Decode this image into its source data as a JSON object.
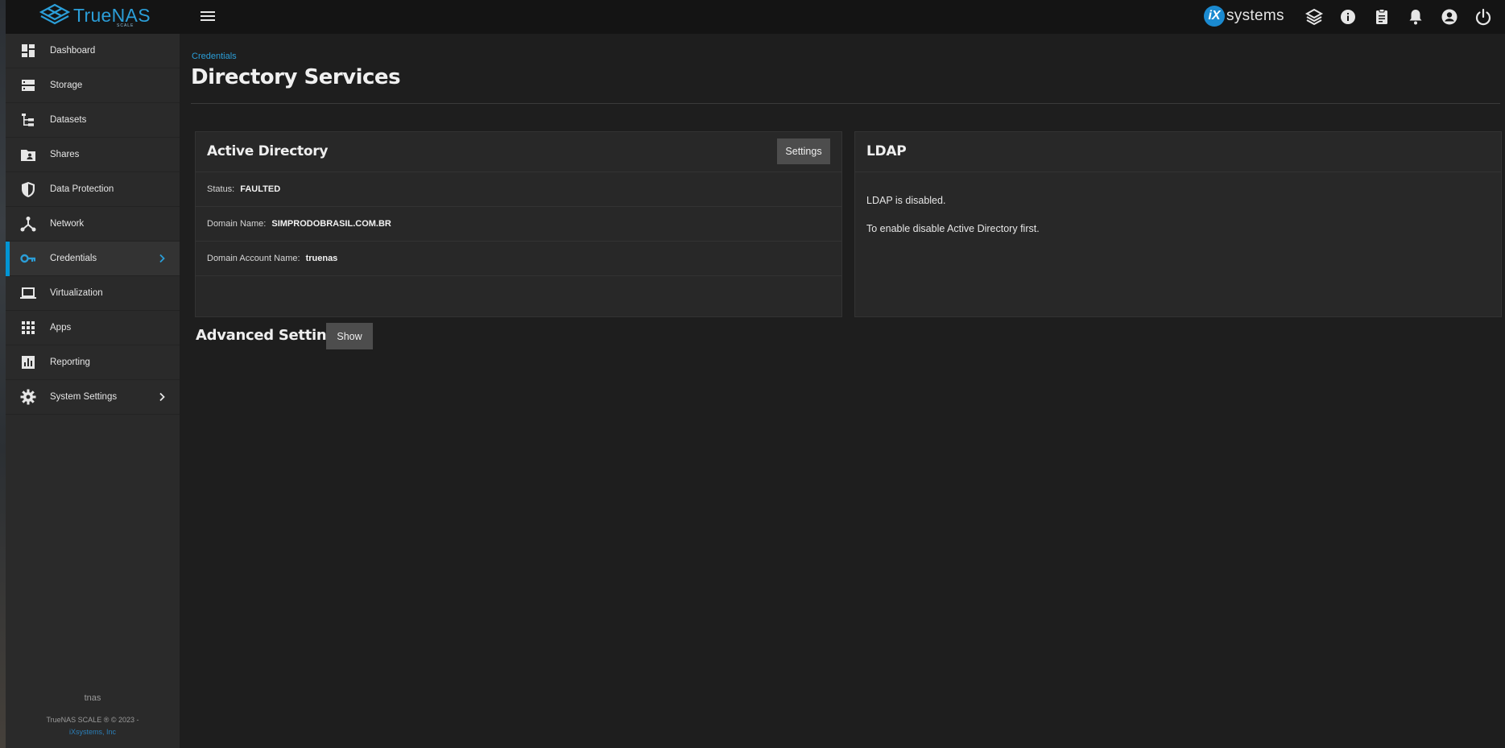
{
  "app": {
    "brand": "TrueNAS",
    "edition": "SCALE",
    "vendor_badge": "iX",
    "vendor_word": "systems"
  },
  "sidebar": {
    "items": [
      {
        "label": "Dashboard",
        "icon": "dashboard-icon"
      },
      {
        "label": "Storage",
        "icon": "storage-icon"
      },
      {
        "label": "Datasets",
        "icon": "datasets-icon"
      },
      {
        "label": "Shares",
        "icon": "shares-icon"
      },
      {
        "label": "Data Protection",
        "icon": "shield-icon"
      },
      {
        "label": "Network",
        "icon": "network-icon"
      },
      {
        "label": "Credentials",
        "icon": "key-icon",
        "active": true
      },
      {
        "label": "Virtualization",
        "icon": "laptop-icon"
      },
      {
        "label": "Apps",
        "icon": "apps-grid-icon"
      },
      {
        "label": "Reporting",
        "icon": "reporting-icon"
      },
      {
        "label": "System Settings",
        "icon": "gear-icon"
      }
    ],
    "hostname": "tnas",
    "copyright": "TrueNAS SCALE ® © 2023 -",
    "copyright_link": "iXsystems, Inc"
  },
  "header": {
    "icons": [
      "truecommand-icon",
      "info-icon",
      "clipboard-icon",
      "bell-icon",
      "account-icon",
      "power-icon"
    ]
  },
  "main": {
    "breadcrumb": "Credentials",
    "title": "Directory Services",
    "active_directory": {
      "title": "Active Directory",
      "settings_label": "Settings",
      "rows": [
        {
          "key": "Status:",
          "value": "FAULTED"
        },
        {
          "key": "Domain Name:",
          "value": "SIMPRODOBRASIL.COM.BR"
        },
        {
          "key": "Domain Account Name:",
          "value": "truenas"
        }
      ]
    },
    "ldap": {
      "title": "LDAP",
      "line1": "LDAP is disabled.",
      "line2": "To enable disable Active Directory first."
    },
    "advanced": {
      "title": "Advanced Settings",
      "show_label": "Show"
    }
  },
  "colors": {
    "accent": "#0095d5",
    "topbar": "#141414",
    "sidebar": "#2a2a2a",
    "background": "#1e1e1e",
    "card": "#282828",
    "button": "#4d4d4d"
  }
}
